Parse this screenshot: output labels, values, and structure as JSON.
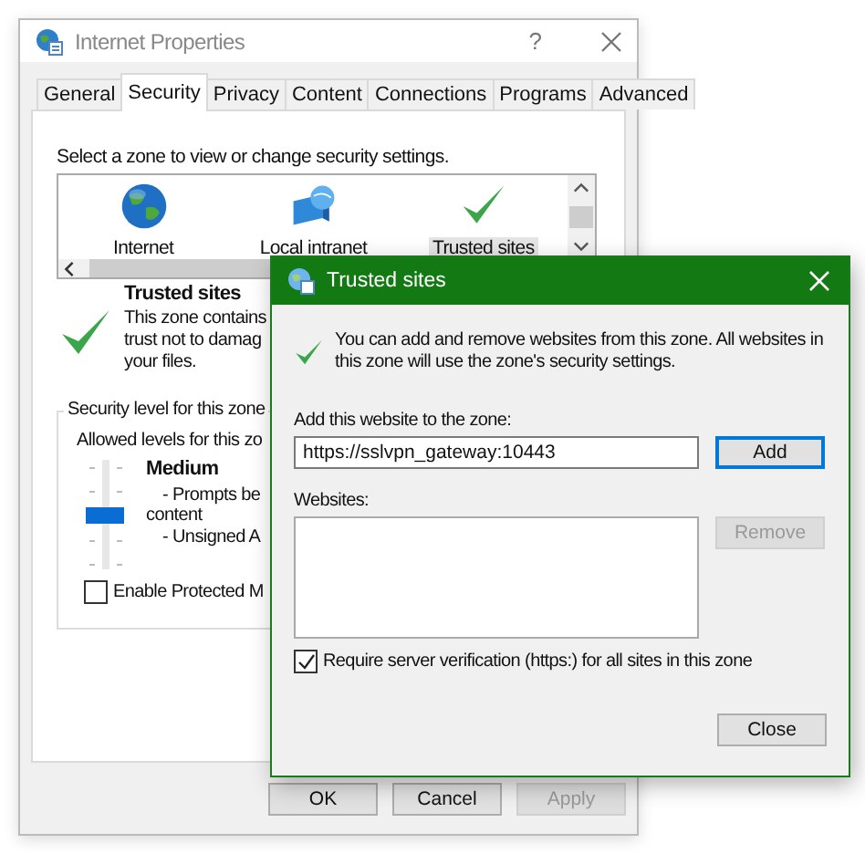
{
  "main_window": {
    "title": "Internet Properties",
    "help_button": "?",
    "tabs": [
      {
        "label": "General",
        "selected": false
      },
      {
        "label": "Security",
        "selected": true
      },
      {
        "label": "Privacy",
        "selected": false
      },
      {
        "label": "Content",
        "selected": false
      },
      {
        "label": "Connections",
        "selected": false
      },
      {
        "label": "Programs",
        "selected": false
      },
      {
        "label": "Advanced",
        "selected": false
      }
    ],
    "zone_prompt": "Select a zone to view or change security settings.",
    "zones": [
      {
        "label": "Internet",
        "kind": "globe",
        "selected": false
      },
      {
        "label": "Local intranet",
        "kind": "intranet",
        "selected": false
      },
      {
        "label": "Trusted sites",
        "kind": "check",
        "selected": true
      }
    ],
    "zone_info": {
      "title": "Trusted sites",
      "lines": [
        "This zone contains",
        "trust not to damag",
        "your files."
      ]
    },
    "security_level": {
      "legend": "Security level for this zone",
      "allowed": "Allowed levels for this zo",
      "level": 0.5,
      "name": "Medium",
      "lines": [
        "- Prompts be",
        "content",
        "- Unsigned A"
      ]
    },
    "protected_mode": {
      "label": "Enable Protected M",
      "checked": false
    },
    "buttons": [
      {
        "label": "OK",
        "disabled": false
      },
      {
        "label": "Cancel",
        "disabled": false
      },
      {
        "label": "Apply",
        "disabled": true
      }
    ]
  },
  "dialog": {
    "title": "Trusted sites",
    "description": "You can add and remove websites from this zone. All websites in this zone will use the zone's security settings.",
    "add_label": "Add this website to the zone:",
    "add_value": "https://sslvpn_gateway:10443",
    "add_button": {
      "label": "Add",
      "disabled": false
    },
    "websites_label": "Websites:",
    "remove_button": {
      "label": "Remove",
      "disabled": true
    },
    "require_https": {
      "label": "Require server verification (https:) for all sites in this zone",
      "checked": true
    },
    "close_button": {
      "label": "Close",
      "disabled": false
    }
  }
}
